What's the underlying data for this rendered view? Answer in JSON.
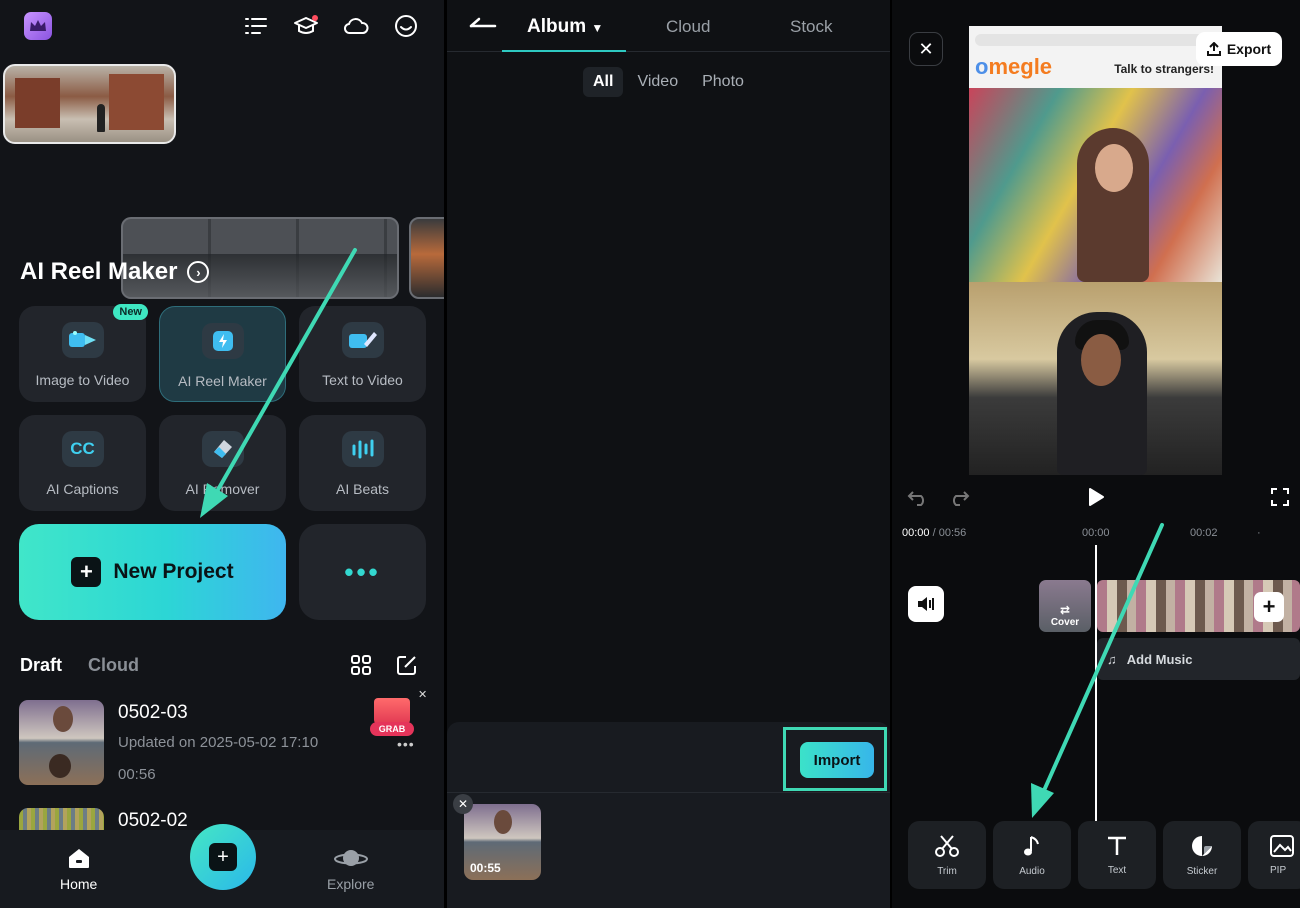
{
  "home": {
    "top_icons": [
      "list-icon",
      "graduation-cap-icon",
      "cloud-icon",
      "smile-icon"
    ],
    "reel_title": "AI Reel Maker",
    "tiles": [
      {
        "label": "Image to Video",
        "icon": "image-video-icon",
        "badge": "New"
      },
      {
        "label": "AI Reel Maker",
        "icon": "lightning-icon"
      },
      {
        "label": "Text to Video",
        "icon": "pencil-video-icon"
      },
      {
        "label": "AI Captions",
        "icon": "cc-icon"
      },
      {
        "label": "AI Remover",
        "icon": "eraser-icon"
      },
      {
        "label": "AI Beats",
        "icon": "beats-icon"
      }
    ],
    "new_project": "New Project",
    "more": "•••",
    "tabs": {
      "draft": "Draft",
      "cloud": "Cloud"
    },
    "gift_label": "GRAB",
    "drafts": [
      {
        "name": "0502-03",
        "updated": "Updated on 2025-05-02 17:10",
        "duration": "00:56"
      },
      {
        "name": "0502-02"
      }
    ],
    "nav": {
      "home": "Home",
      "explore": "Explore"
    }
  },
  "album": {
    "tabs": {
      "album": "Album",
      "cloud": "Cloud",
      "stock": "Stock"
    },
    "filters": [
      "All",
      "Video",
      "Photo"
    ],
    "import_label": "Import",
    "selected_duration": "00:55"
  },
  "editor": {
    "export_label": "Export",
    "preview": {
      "site": "megle",
      "site_first": "o",
      "tagline": "Talk to strangers!"
    },
    "time_current": "00:00",
    "time_total": "00:56",
    "marks": [
      "00:00",
      "00:02"
    ],
    "cover_label": "Cover",
    "add_music": "Add Music",
    "tools": [
      "Trim",
      "Audio",
      "Text",
      "Sticker",
      "PIP"
    ]
  },
  "colors": {
    "accent": "#3fd9b4",
    "background": "#121418"
  }
}
